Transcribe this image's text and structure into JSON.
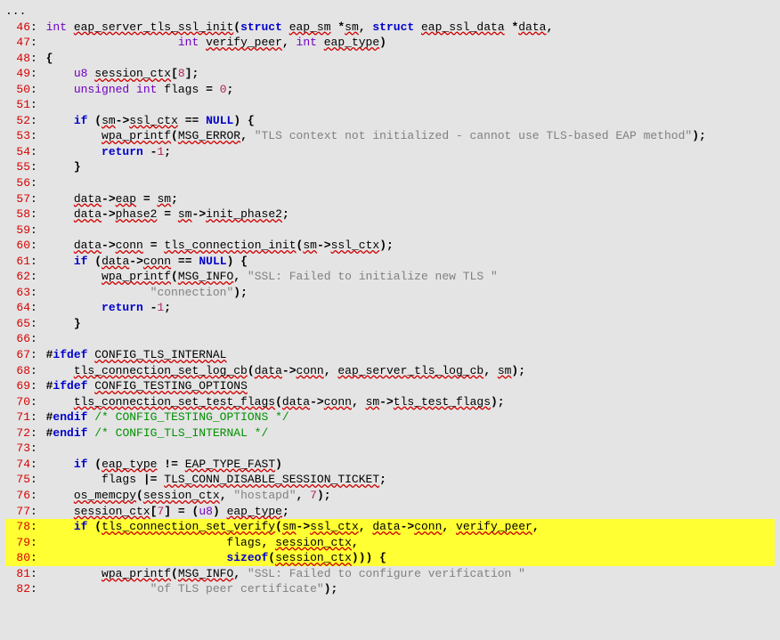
{
  "ellipsis": "...",
  "lines": [
    {
      "n": 46,
      "hl": false,
      "tokens": [
        {
          "cls": "ty",
          "t": "int"
        },
        {
          "t": " "
        },
        {
          "cls": "fn",
          "t": "eap_server_tls_ssl_init"
        },
        {
          "cls": "pl",
          "t": "("
        },
        {
          "cls": "kw",
          "t": "struct"
        },
        {
          "t": " "
        },
        {
          "cls": "var",
          "t": "eap_sm"
        },
        {
          "t": " "
        },
        {
          "cls": "op",
          "t": "*"
        },
        {
          "cls": "var",
          "t": "sm"
        },
        {
          "cls": "pl",
          "t": ","
        },
        {
          "t": " "
        },
        {
          "cls": "kw",
          "t": "struct"
        },
        {
          "t": " "
        },
        {
          "cls": "var",
          "t": "eap_ssl_data"
        },
        {
          "t": " "
        },
        {
          "cls": "op",
          "t": "*"
        },
        {
          "cls": "var",
          "t": "data"
        },
        {
          "cls": "pl",
          "t": ","
        }
      ]
    },
    {
      "n": 47,
      "hl": false,
      "indent": "                   ",
      "tokens": [
        {
          "cls": "ty",
          "t": "int"
        },
        {
          "t": " "
        },
        {
          "cls": "var",
          "t": "verify_peer"
        },
        {
          "cls": "pl",
          "t": ","
        },
        {
          "t": " "
        },
        {
          "cls": "ty",
          "t": "int"
        },
        {
          "t": " "
        },
        {
          "cls": "var",
          "t": "eap_type"
        },
        {
          "cls": "pl",
          "t": ")"
        }
      ]
    },
    {
      "n": 48,
      "hl": false,
      "tokens": [
        {
          "cls": "pl",
          "t": "{"
        }
      ]
    },
    {
      "n": 49,
      "hl": false,
      "indent": "    ",
      "tokens": [
        {
          "cls": "ty",
          "t": "u8"
        },
        {
          "t": " "
        },
        {
          "cls": "var",
          "t": "session_ctx"
        },
        {
          "cls": "pl",
          "t": "["
        },
        {
          "cls": "num",
          "t": "8"
        },
        {
          "cls": "pl",
          "t": "];"
        }
      ]
    },
    {
      "n": 50,
      "hl": false,
      "indent": "    ",
      "tokens": [
        {
          "cls": "ty",
          "t": "unsigned int"
        },
        {
          "t": " "
        },
        {
          "cls": "id",
          "t": "flags"
        },
        {
          "t": " "
        },
        {
          "cls": "op",
          "t": "="
        },
        {
          "t": " "
        },
        {
          "cls": "num",
          "t": "0"
        },
        {
          "cls": "pl",
          "t": ";"
        }
      ]
    },
    {
      "n": 51,
      "hl": false,
      "tokens": [
        {
          "t": ""
        }
      ]
    },
    {
      "n": 52,
      "hl": false,
      "indent": "    ",
      "tokens": [
        {
          "cls": "kw",
          "t": "if"
        },
        {
          "t": " "
        },
        {
          "cls": "pl",
          "t": "("
        },
        {
          "cls": "var",
          "t": "sm"
        },
        {
          "cls": "op",
          "t": "->"
        },
        {
          "cls": "var",
          "t": "ssl_ctx"
        },
        {
          "t": " "
        },
        {
          "cls": "op",
          "t": "=="
        },
        {
          "t": " "
        },
        {
          "cls": "kw",
          "t": "NULL"
        },
        {
          "cls": "pl",
          "t": ")"
        },
        {
          "t": " "
        },
        {
          "cls": "pl",
          "t": "{"
        }
      ]
    },
    {
      "n": 53,
      "hl": false,
      "indent": "        ",
      "wrap": true,
      "tokens": [
        {
          "cls": "fn",
          "t": "wpa_printf"
        },
        {
          "cls": "pl",
          "t": "("
        },
        {
          "cls": "var",
          "t": "MSG_ERROR"
        },
        {
          "cls": "pl",
          "t": ","
        },
        {
          "t": " "
        },
        {
          "cls": "str",
          "t": "\"TLS context not initialized - cannot use TLS-based EAP method\""
        },
        {
          "cls": "pl",
          "t": ");"
        }
      ]
    },
    {
      "n": 54,
      "hl": false,
      "indent": "        ",
      "tokens": [
        {
          "cls": "kw",
          "t": "return"
        },
        {
          "t": " "
        },
        {
          "cls": "op",
          "t": "-"
        },
        {
          "cls": "num",
          "t": "1"
        },
        {
          "cls": "pl",
          "t": ";"
        }
      ]
    },
    {
      "n": 55,
      "hl": false,
      "indent": "    ",
      "tokens": [
        {
          "cls": "pl",
          "t": "}"
        }
      ]
    },
    {
      "n": 56,
      "hl": false,
      "tokens": [
        {
          "t": ""
        }
      ]
    },
    {
      "n": 57,
      "hl": false,
      "indent": "    ",
      "tokens": [
        {
          "cls": "var",
          "t": "data"
        },
        {
          "cls": "op",
          "t": "->"
        },
        {
          "cls": "var",
          "t": "eap"
        },
        {
          "t": " "
        },
        {
          "cls": "op",
          "t": "="
        },
        {
          "t": " "
        },
        {
          "cls": "var",
          "t": "sm"
        },
        {
          "cls": "pl",
          "t": ";"
        }
      ]
    },
    {
      "n": 58,
      "hl": false,
      "indent": "    ",
      "tokens": [
        {
          "cls": "var",
          "t": "data"
        },
        {
          "cls": "op",
          "t": "->"
        },
        {
          "cls": "var",
          "t": "phase2"
        },
        {
          "t": " "
        },
        {
          "cls": "op",
          "t": "="
        },
        {
          "t": " "
        },
        {
          "cls": "var",
          "t": "sm"
        },
        {
          "cls": "op",
          "t": "->"
        },
        {
          "cls": "var",
          "t": "init_phase2"
        },
        {
          "cls": "pl",
          "t": ";"
        }
      ]
    },
    {
      "n": 59,
      "hl": false,
      "tokens": [
        {
          "t": ""
        }
      ]
    },
    {
      "n": 60,
      "hl": false,
      "indent": "    ",
      "tokens": [
        {
          "cls": "var",
          "t": "data"
        },
        {
          "cls": "op",
          "t": "->"
        },
        {
          "cls": "var",
          "t": "conn"
        },
        {
          "t": " "
        },
        {
          "cls": "op",
          "t": "="
        },
        {
          "t": " "
        },
        {
          "cls": "fn",
          "t": "tls_connection_init"
        },
        {
          "cls": "pl",
          "t": "("
        },
        {
          "cls": "var",
          "t": "sm"
        },
        {
          "cls": "op",
          "t": "->"
        },
        {
          "cls": "var",
          "t": "ssl_ctx"
        },
        {
          "cls": "pl",
          "t": ");"
        }
      ]
    },
    {
      "n": 61,
      "hl": false,
      "indent": "    ",
      "tokens": [
        {
          "cls": "kw",
          "t": "if"
        },
        {
          "t": " "
        },
        {
          "cls": "pl",
          "t": "("
        },
        {
          "cls": "var",
          "t": "data"
        },
        {
          "cls": "op",
          "t": "->"
        },
        {
          "cls": "var",
          "t": "conn"
        },
        {
          "t": " "
        },
        {
          "cls": "op",
          "t": "=="
        },
        {
          "t": " "
        },
        {
          "cls": "kw",
          "t": "NULL"
        },
        {
          "cls": "pl",
          "t": ")"
        },
        {
          "t": " "
        },
        {
          "cls": "pl",
          "t": "{"
        }
      ]
    },
    {
      "n": 62,
      "hl": false,
      "indent": "        ",
      "tokens": [
        {
          "cls": "fn",
          "t": "wpa_printf"
        },
        {
          "cls": "pl",
          "t": "("
        },
        {
          "cls": "var",
          "t": "MSG_INFO"
        },
        {
          "cls": "pl",
          "t": ","
        },
        {
          "t": " "
        },
        {
          "cls": "str",
          "t": "\"SSL: Failed to initialize new TLS \""
        }
      ]
    },
    {
      "n": 63,
      "hl": false,
      "indent": "               ",
      "tokens": [
        {
          "cls": "str",
          "t": "\"connection\""
        },
        {
          "cls": "pl",
          "t": ");"
        }
      ]
    },
    {
      "n": 64,
      "hl": false,
      "indent": "        ",
      "tokens": [
        {
          "cls": "kw",
          "t": "return"
        },
        {
          "t": " "
        },
        {
          "cls": "op",
          "t": "-"
        },
        {
          "cls": "num",
          "t": "1"
        },
        {
          "cls": "pl",
          "t": ";"
        }
      ]
    },
    {
      "n": 65,
      "hl": false,
      "indent": "    ",
      "tokens": [
        {
          "cls": "pl",
          "t": "}"
        }
      ]
    },
    {
      "n": 66,
      "hl": false,
      "tokens": [
        {
          "t": ""
        }
      ]
    },
    {
      "n": 67,
      "hl": false,
      "tokens": [
        {
          "cls": "pl",
          "t": "#"
        },
        {
          "cls": "kw",
          "t": "ifdef"
        },
        {
          "t": " "
        },
        {
          "cls": "var",
          "t": "CONFIG_TLS_INTERNAL"
        }
      ]
    },
    {
      "n": 68,
      "hl": false,
      "indent": "    ",
      "tokens": [
        {
          "cls": "fn",
          "t": "tls_connection_set_log_cb"
        },
        {
          "cls": "pl",
          "t": "("
        },
        {
          "cls": "var",
          "t": "data"
        },
        {
          "cls": "op",
          "t": "->"
        },
        {
          "cls": "var",
          "t": "conn"
        },
        {
          "cls": "pl",
          "t": ","
        },
        {
          "t": " "
        },
        {
          "cls": "var",
          "t": "eap_server_tls_log_cb"
        },
        {
          "cls": "pl",
          "t": ","
        },
        {
          "t": " "
        },
        {
          "cls": "var",
          "t": "sm"
        },
        {
          "cls": "pl",
          "t": ");"
        }
      ]
    },
    {
      "n": 69,
      "hl": false,
      "tokens": [
        {
          "cls": "pl",
          "t": "#"
        },
        {
          "cls": "kw",
          "t": "ifdef"
        },
        {
          "t": " "
        },
        {
          "cls": "var",
          "t": "CONFIG_TESTING_OPTIONS"
        }
      ]
    },
    {
      "n": 70,
      "hl": false,
      "indent": "    ",
      "tokens": [
        {
          "cls": "fn",
          "t": "tls_connection_set_test_flags"
        },
        {
          "cls": "pl",
          "t": "("
        },
        {
          "cls": "var",
          "t": "data"
        },
        {
          "cls": "op",
          "t": "->"
        },
        {
          "cls": "var",
          "t": "conn"
        },
        {
          "cls": "pl",
          "t": ","
        },
        {
          "t": " "
        },
        {
          "cls": "var",
          "t": "sm"
        },
        {
          "cls": "op",
          "t": "->"
        },
        {
          "cls": "var",
          "t": "tls_test_flags"
        },
        {
          "cls": "pl",
          "t": ");"
        }
      ]
    },
    {
      "n": 71,
      "hl": false,
      "tokens": [
        {
          "cls": "pl",
          "t": "#"
        },
        {
          "cls": "kw",
          "t": "endif"
        },
        {
          "t": " "
        },
        {
          "cls": "cmt",
          "t": "/* CONFIG_TESTING_OPTIONS */"
        }
      ]
    },
    {
      "n": 72,
      "hl": false,
      "tokens": [
        {
          "cls": "pl",
          "t": "#"
        },
        {
          "cls": "kw",
          "t": "endif"
        },
        {
          "t": " "
        },
        {
          "cls": "cmt",
          "t": "/* CONFIG_TLS_INTERNAL */"
        }
      ]
    },
    {
      "n": 73,
      "hl": false,
      "tokens": [
        {
          "t": ""
        }
      ]
    },
    {
      "n": 74,
      "hl": false,
      "indent": "    ",
      "tokens": [
        {
          "cls": "kw",
          "t": "if"
        },
        {
          "t": " "
        },
        {
          "cls": "pl",
          "t": "("
        },
        {
          "cls": "var",
          "t": "eap_type"
        },
        {
          "t": " "
        },
        {
          "cls": "op",
          "t": "!="
        },
        {
          "t": " "
        },
        {
          "cls": "var",
          "t": "EAP_TYPE_FAST"
        },
        {
          "cls": "pl",
          "t": ")"
        }
      ]
    },
    {
      "n": 75,
      "hl": false,
      "indent": "        ",
      "tokens": [
        {
          "cls": "id",
          "t": "flags"
        },
        {
          "t": " "
        },
        {
          "cls": "op",
          "t": "|="
        },
        {
          "t": " "
        },
        {
          "cls": "var",
          "t": "TLS_CONN_DISABLE_SESSION_TICKET"
        },
        {
          "cls": "pl",
          "t": ";"
        }
      ]
    },
    {
      "n": 76,
      "hl": false,
      "indent": "    ",
      "tokens": [
        {
          "cls": "fn",
          "t": "os_memcpy"
        },
        {
          "cls": "pl",
          "t": "("
        },
        {
          "cls": "var",
          "t": "session_ctx"
        },
        {
          "cls": "pl",
          "t": ","
        },
        {
          "t": " "
        },
        {
          "cls": "str",
          "t": "\"hostapd\""
        },
        {
          "cls": "pl",
          "t": ","
        },
        {
          "t": " "
        },
        {
          "cls": "num",
          "t": "7"
        },
        {
          "cls": "pl",
          "t": ");"
        }
      ]
    },
    {
      "n": 77,
      "hl": false,
      "indent": "    ",
      "tokens": [
        {
          "cls": "var",
          "t": "session_ctx"
        },
        {
          "cls": "pl",
          "t": "["
        },
        {
          "cls": "num",
          "t": "7"
        },
        {
          "cls": "pl",
          "t": "]"
        },
        {
          "t": " "
        },
        {
          "cls": "op",
          "t": "="
        },
        {
          "t": " "
        },
        {
          "cls": "pl",
          "t": "("
        },
        {
          "cls": "ty",
          "t": "u8"
        },
        {
          "cls": "pl",
          "t": ")"
        },
        {
          "t": " "
        },
        {
          "cls": "var",
          "t": "eap_type"
        },
        {
          "cls": "pl",
          "t": ";"
        }
      ]
    },
    {
      "n": 78,
      "hl": true,
      "indent": "    ",
      "tokens": [
        {
          "cls": "kw",
          "t": "if"
        },
        {
          "t": " "
        },
        {
          "cls": "pl",
          "t": "("
        },
        {
          "cls": "fn",
          "t": "tls_connection_set_verify"
        },
        {
          "cls": "pl",
          "t": "("
        },
        {
          "cls": "var",
          "t": "sm"
        },
        {
          "cls": "op",
          "t": "->"
        },
        {
          "cls": "var",
          "t": "ssl_ctx"
        },
        {
          "cls": "pl",
          "t": ","
        },
        {
          "t": " "
        },
        {
          "cls": "var",
          "t": "data"
        },
        {
          "cls": "op",
          "t": "->"
        },
        {
          "cls": "var",
          "t": "conn"
        },
        {
          "cls": "pl",
          "t": ","
        },
        {
          "t": " "
        },
        {
          "cls": "var",
          "t": "verify_peer"
        },
        {
          "cls": "pl",
          "t": ","
        }
      ]
    },
    {
      "n": 79,
      "hl": true,
      "indent": "                          ",
      "tokens": [
        {
          "cls": "id",
          "t": "flags"
        },
        {
          "cls": "pl",
          "t": ","
        },
        {
          "t": " "
        },
        {
          "cls": "var",
          "t": "session_ctx"
        },
        {
          "cls": "pl",
          "t": ","
        }
      ]
    },
    {
      "n": 80,
      "hl": true,
      "indent": "                          ",
      "tokens": [
        {
          "cls": "kw",
          "t": "sizeof"
        },
        {
          "cls": "pl",
          "t": "("
        },
        {
          "cls": "var",
          "t": "session_ctx"
        },
        {
          "cls": "pl",
          "t": ")))"
        },
        {
          "t": " "
        },
        {
          "cls": "pl",
          "t": "{"
        }
      ]
    },
    {
      "n": 81,
      "hl": false,
      "indent": "        ",
      "tokens": [
        {
          "cls": "fn",
          "t": "wpa_printf"
        },
        {
          "cls": "pl",
          "t": "("
        },
        {
          "cls": "var",
          "t": "MSG_INFO"
        },
        {
          "cls": "pl",
          "t": ","
        },
        {
          "t": " "
        },
        {
          "cls": "str",
          "t": "\"SSL: Failed to configure verification \""
        }
      ]
    },
    {
      "n": 82,
      "hl": false,
      "indent": "               ",
      "tokens": [
        {
          "cls": "str",
          "t": "\"of TLS peer certificate\""
        },
        {
          "cls": "pl",
          "t": ");"
        }
      ]
    }
  ]
}
